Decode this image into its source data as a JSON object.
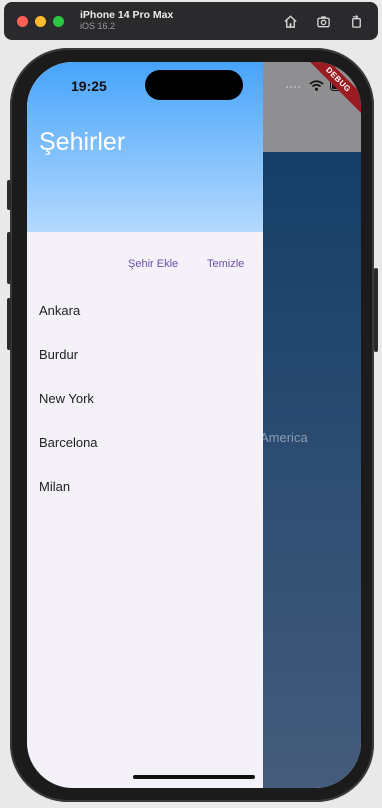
{
  "simulator": {
    "device_name": "iPhone 14 Pro Max",
    "os_version": "iOS 16.2",
    "tools": [
      "home-icon",
      "screenshot-icon",
      "rotate-icon"
    ]
  },
  "status_bar": {
    "time": "19:25"
  },
  "debug_banner": "DEBUG",
  "background": {
    "partial_text": "America"
  },
  "drawer": {
    "title": "Şehirler",
    "add_city_button": "Şehir Ekle",
    "clear_button": "Temizle",
    "cities": [
      "Ankara",
      "Burdur",
      "New York",
      "Barcelona",
      "Milan"
    ]
  },
  "colors": {
    "header_top": "#47a4fb",
    "header_bottom": "#b4d9fe",
    "accent": "#6b4fa3",
    "drawer_bg": "#f5f1f9"
  }
}
